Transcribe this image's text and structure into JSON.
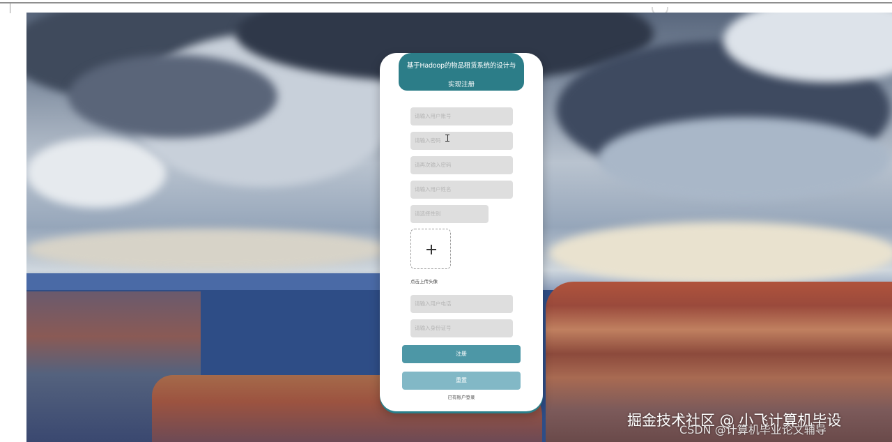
{
  "card": {
    "title_line1": "基于Hadoop的物品租赁系统的设计与",
    "title_line2": "实现注册",
    "fields": [
      {
        "placeholder": "请输入用户账号"
      },
      {
        "placeholder": "请输入密码"
      },
      {
        "placeholder": "请再次输入密码"
      },
      {
        "placeholder": "请输入用户姓名"
      },
      {
        "placeholder": "请选择性别"
      }
    ],
    "upload_label": "点击上传头像",
    "fields_after": [
      {
        "placeholder": "请输入用户电话"
      },
      {
        "placeholder": "请输入身份证号"
      }
    ],
    "register_label": "注册",
    "reset_label": "重置",
    "login_link": "已有账户登录"
  },
  "watermark": {
    "line1": "掘金技术社区 @ 小飞计算机毕设",
    "line2": "CSDN @计算机毕业论文辅导"
  },
  "colors": {
    "header": "#2c7d88",
    "register_button": "#4d97a6",
    "reset_button": "#82b8c6",
    "field_bg": "#dedede"
  }
}
